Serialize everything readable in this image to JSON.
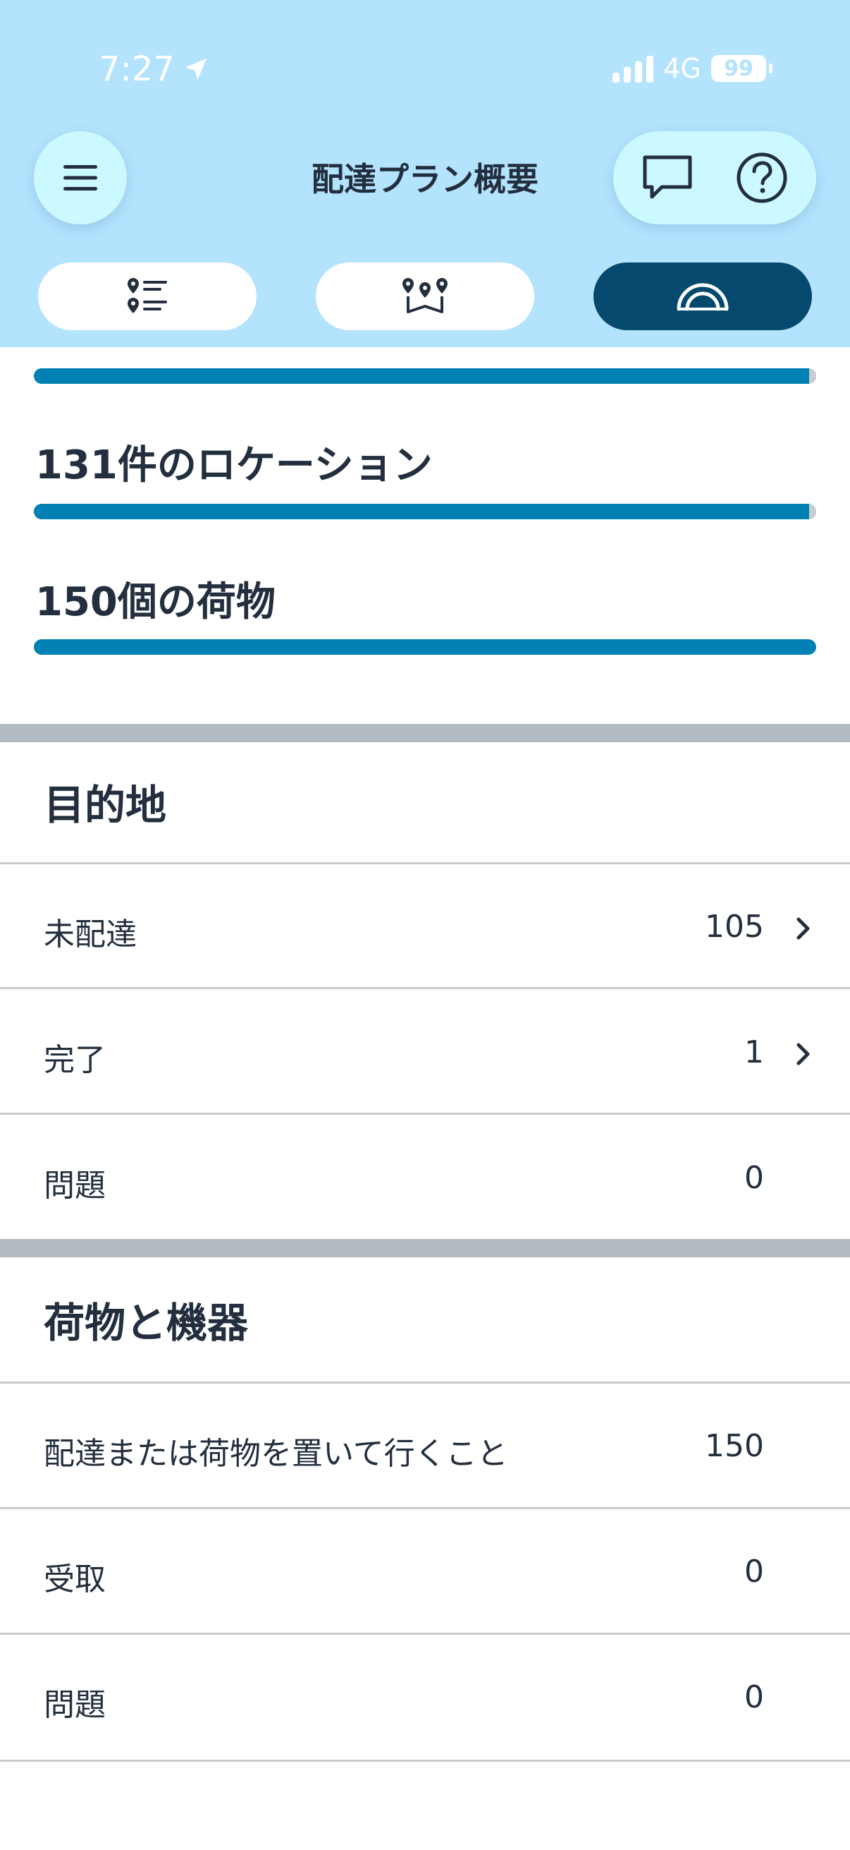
{
  "status_bar": {
    "time": "7:27",
    "network": "4G",
    "battery": "99"
  },
  "header": {
    "title": "配達プラン概要"
  },
  "icons": {
    "menu": "menu-icon",
    "chat": "chat-icon",
    "help": "help-icon",
    "list": "list-pin-icon",
    "map": "map-route-icon",
    "summary": "gauge-icon",
    "location": "location-arrow-icon",
    "chevron": "chevron-right-icon"
  },
  "colors": {
    "header_bg": "#b3e3fd",
    "accent": "#0080b3",
    "active_tab": "#054a6e"
  },
  "summary": {
    "top_progress": 0.99,
    "locations_label": "131件のロケーション",
    "locations_progress": 0.99,
    "packages_label": "150個の荷物",
    "packages_progress": 1.0
  },
  "destinations": {
    "title": "目的地",
    "rows": [
      {
        "label": "未配達",
        "value": "105"
      },
      {
        "label": "完了",
        "value": "1"
      },
      {
        "label": "問題",
        "value": "0"
      }
    ]
  },
  "packages_equipment": {
    "title": "荷物と機器",
    "rows": [
      {
        "label": "配達または荷物を置いて行くこと",
        "value": "150"
      },
      {
        "label": "受取",
        "value": "0"
      },
      {
        "label": "問題",
        "value": "0"
      }
    ]
  }
}
